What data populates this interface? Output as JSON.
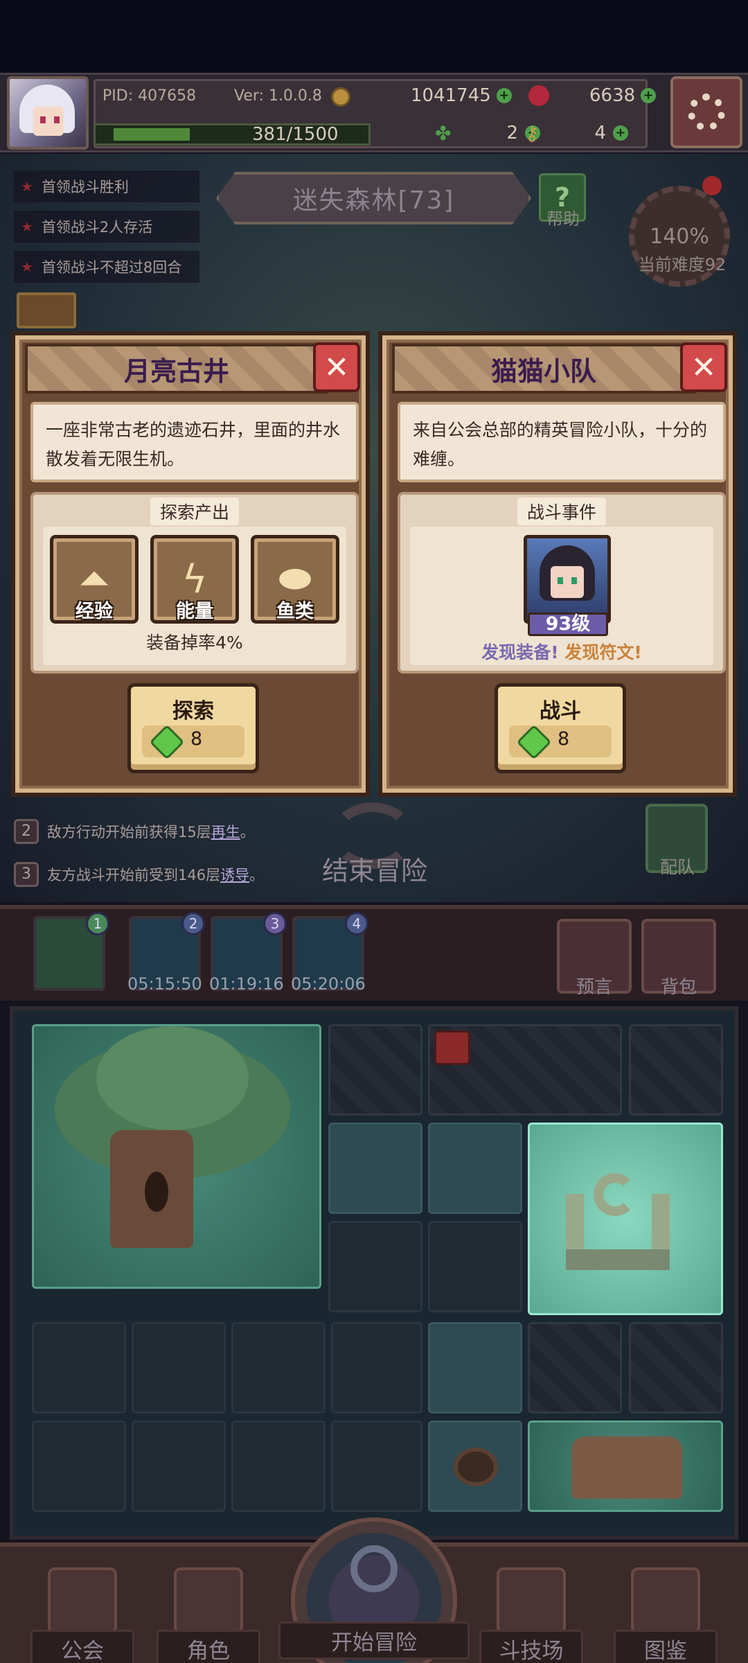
{
  "hud": {
    "pid": "PID: 407658",
    "version": "Ver: 1.0.0.8",
    "gold": "1041745",
    "apples": "6638",
    "energy": "381/1500",
    "clovers": "2",
    "keys": "4"
  },
  "objectives": [
    "首领战斗胜利",
    "首领战斗2人存活",
    "首领战斗不超过8回合"
  ],
  "location": {
    "title": "迷失森林[73]",
    "help": "帮助",
    "speed": "140%",
    "difficulty": "当前难度92"
  },
  "cards": [
    {
      "title": "月亮古井",
      "close": "✕",
      "description": "一座非常古老的遗迹石井，里面的井水散发着无限生机。",
      "section": "探索产出",
      "rewards": [
        {
          "label": "经验",
          "icon": "chevron-up-icon"
        },
        {
          "label": "能量",
          "icon": "lightning-icon"
        },
        {
          "label": "鱼类",
          "icon": "fish-icon"
        }
      ],
      "drop": "装备掉率4%",
      "action": "探索",
      "cost": "8"
    },
    {
      "title": "猫猫小队",
      "close": "✕",
      "description": "来自公会总部的精英冒险小队，十分的难缠。",
      "section": "战斗事件",
      "level": "93级",
      "find_equipment": "发现装备!",
      "find_rune": "发现符文!",
      "action": "战斗",
      "cost": "8"
    }
  ],
  "effects": [
    {
      "num": "2",
      "text_pre": "敌方行动开始前获得15层",
      "highlight": "再生",
      "text_post": "。"
    },
    {
      "num": "3",
      "text_pre": "友方战斗开始前受到146层",
      "highlight": "诱导",
      "text_post": "。"
    }
  ],
  "end_adventure": "结束冒险",
  "team": "配队",
  "map_slots": [
    {
      "num": "1",
      "time": ""
    },
    {
      "num": "2",
      "time": "05:15:50"
    },
    {
      "num": "3",
      "time": "01:19:16"
    },
    {
      "num": "4",
      "time": "05:20:06"
    }
  ],
  "side_buttons": {
    "prophecy": "预言",
    "backpack": "背包"
  },
  "nav": {
    "guild": "公会",
    "character": "角色",
    "start": "开始冒险",
    "arena": "斗技场",
    "codex": "图鉴"
  },
  "colors": {
    "card_title": "#3a1c4e",
    "close_red": "#d24a4a",
    "gem_green": "#5fc84a",
    "level_purple": "#6c5ca8",
    "find_equipment": "#7a6ab0",
    "find_rune": "#c9823a"
  }
}
